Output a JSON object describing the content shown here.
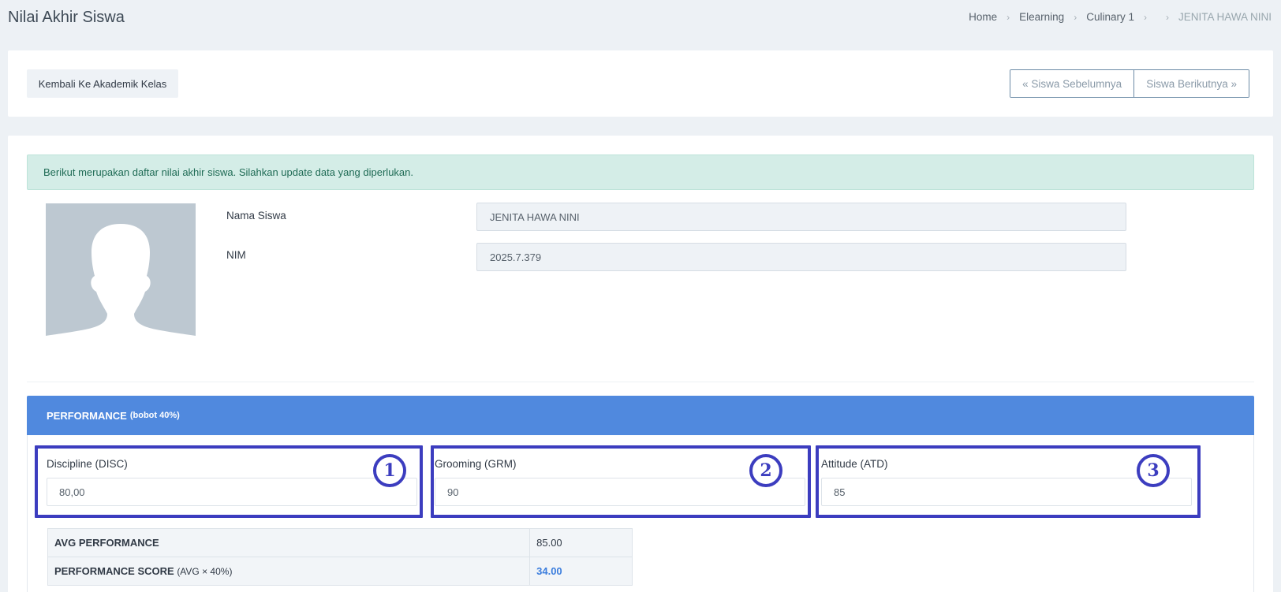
{
  "header": {
    "title": "Nilai Akhir Siswa",
    "breadcrumb": [
      "Home",
      "Elearning",
      "Culinary 1",
      "",
      "JENITA HAWA NINI"
    ]
  },
  "toolbar": {
    "back_label": "Kembali Ke Akademik Kelas",
    "prev_label": "« Siswa Sebelumnya",
    "next_label": "Siswa Berikutnya »"
  },
  "alert": {
    "text": "Berikut merupakan daftar nilai akhir siswa. Silahkan update data yang diperlukan."
  },
  "student": {
    "name_label": "Nama Siswa",
    "name_value": "JENITA HAWA NINI",
    "nim_label": "NIM",
    "nim_value": "2025.7.379"
  },
  "performance": {
    "title": "PERFORMANCE",
    "weight": "(bobot 40%)",
    "fields": [
      {
        "label": "Discipline (DISC)",
        "value": "80,00",
        "marker": "1"
      },
      {
        "label": "Grooming (GRM)",
        "value": "90",
        "marker": "2"
      },
      {
        "label": "Attitude (ATD)",
        "value": "85",
        "marker": "3"
      }
    ],
    "summary": [
      {
        "label": "AVG PERFORMANCE",
        "sub": "",
        "value": "85.00"
      },
      {
        "label": "PERFORMANCE SCORE",
        "sub": "(AVG × 40%)",
        "value": "34.00"
      }
    ]
  },
  "colors": {
    "accent": "#5089de",
    "highlight": "#3c3dbf",
    "alert_bg": "#d4ede7"
  }
}
